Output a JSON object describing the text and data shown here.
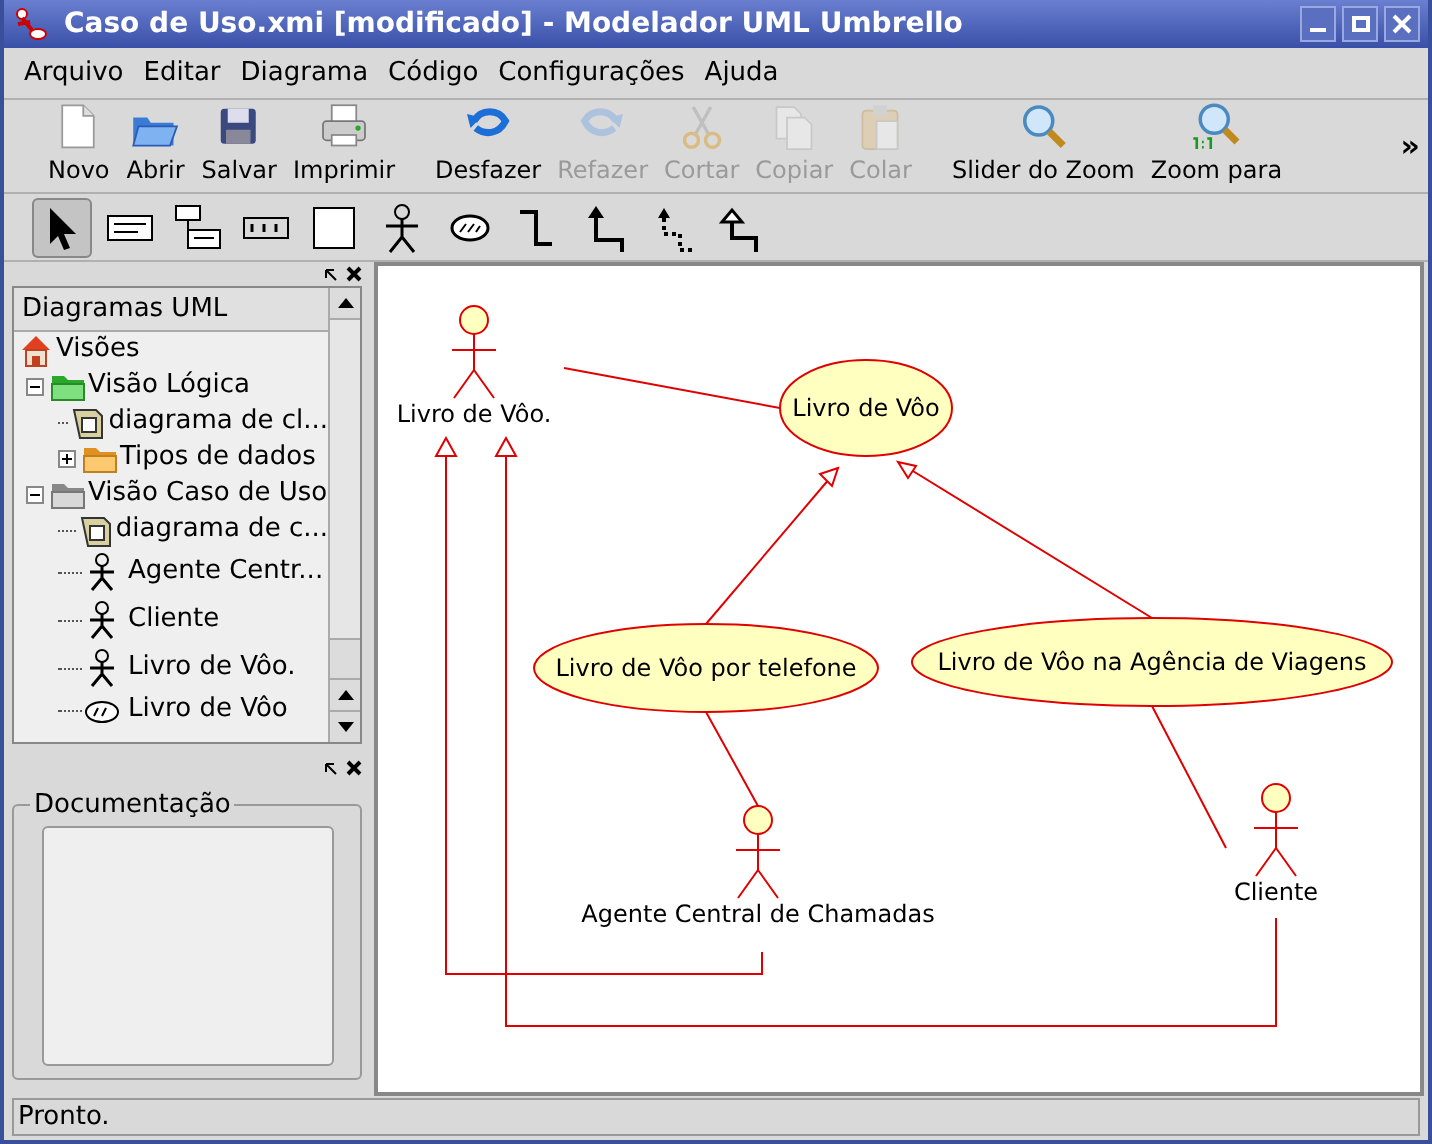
{
  "window": {
    "title": "Caso de Uso.xmi [modificado] - Modelador UML Umbrello"
  },
  "menu": [
    "Arquivo",
    "Editar",
    "Diagrama",
    "Código",
    "Configurações",
    "Ajuda"
  ],
  "toolbar": [
    {
      "kind": "new",
      "label": "Novo",
      "disabled": false
    },
    {
      "kind": "open",
      "label": "Abrir",
      "disabled": false
    },
    {
      "kind": "save",
      "label": "Salvar",
      "disabled": false
    },
    {
      "kind": "print",
      "label": "Imprimir",
      "disabled": false
    },
    {
      "kind": "undo",
      "label": "Desfazer",
      "disabled": false
    },
    {
      "kind": "redo",
      "label": "Refazer",
      "disabled": true
    },
    {
      "kind": "cut",
      "label": "Cortar",
      "disabled": true
    },
    {
      "kind": "copy",
      "label": "Copiar",
      "disabled": true
    },
    {
      "kind": "paste",
      "label": "Colar",
      "disabled": true
    },
    {
      "kind": "zoom",
      "label": "Slider do Zoom",
      "disabled": false
    },
    {
      "kind": "zoom100",
      "label": "Zoom para",
      "disabled": false
    }
  ],
  "toolbar_overflow": "»",
  "palette": [
    {
      "kind": "select",
      "selected": true
    },
    {
      "kind": "text",
      "selected": false
    },
    {
      "kind": "note",
      "selected": false
    },
    {
      "kind": "dbc",
      "selected": false
    },
    {
      "kind": "box",
      "selected": false
    },
    {
      "kind": "actor",
      "selected": false
    },
    {
      "kind": "usecase",
      "selected": false
    },
    {
      "kind": "dependency",
      "selected": false
    },
    {
      "kind": "association",
      "selected": false
    },
    {
      "kind": "aggregation",
      "selected": false
    },
    {
      "kind": "generalization",
      "selected": false
    }
  ],
  "tree": {
    "header": "Diagramas UML",
    "items": [
      {
        "kind": "root",
        "label": "Visões",
        "children": [
          {
            "kind": "folder-green",
            "label": "Visão Lógica",
            "expanded": true,
            "children": [
              {
                "kind": "diagram",
                "label": "diagrama de cl..."
              },
              {
                "kind": "folder-orange",
                "label": "Tipos de dados",
                "expanded": false
              }
            ]
          },
          {
            "kind": "folder-gray",
            "label": "Visão Caso de Uso",
            "expanded": true,
            "children": [
              {
                "kind": "diagram",
                "label": "diagrama de c..."
              },
              {
                "kind": "actor",
                "label": "Agente Centr..."
              },
              {
                "kind": "actor",
                "label": "Cliente"
              },
              {
                "kind": "actor",
                "label": "Livro de Vôo."
              },
              {
                "kind": "usecase",
                "label": "Livro de Vôo"
              }
            ]
          }
        ]
      }
    ]
  },
  "documentation": {
    "title": "Documentação"
  },
  "diagram": {
    "actors": [
      "Livro de Vôo.",
      "Agente Central de Chamadas",
      "Cliente"
    ],
    "use_cases": [
      "Livro de Vôo",
      "Livro de Vôo por telefone",
      "Livro de Vôo na Agência de Viagens"
    ]
  },
  "status_bar": "Pronto."
}
